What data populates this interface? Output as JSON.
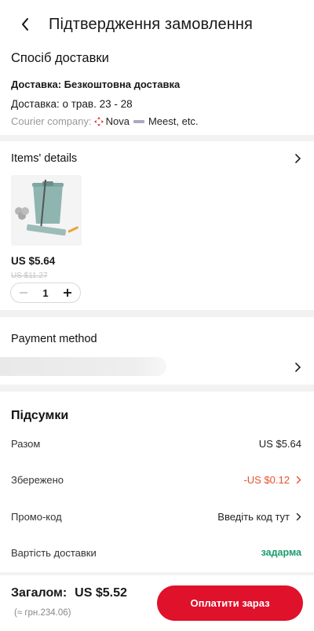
{
  "header": {
    "title": "Підтвердження замовлення"
  },
  "delivery": {
    "title": "Спосіб доставки",
    "method": "Доставка: Безкоштовна доставка",
    "date": "Доставка: о трав. 23 - 28",
    "courier_label": "Courier company:",
    "courier_nova": "Nova",
    "courier_meest": "Meest, etc."
  },
  "items": {
    "title": "Items' details",
    "price": "US $5.64",
    "old_price": "US $11.27",
    "quantity": "1"
  },
  "payment": {
    "title": "Payment method"
  },
  "summary": {
    "title": "Підсумки",
    "rows": [
      {
        "label": "Разом",
        "value": "US $5.64"
      },
      {
        "label": "Збережено",
        "value": "-US $0.12"
      },
      {
        "label": "Промо-код",
        "value": "Введіть код тут"
      },
      {
        "label": "Вартість доставки",
        "value": "задарма"
      }
    ]
  },
  "footer": {
    "total_label": "Загалом:",
    "total_amount": "US $5.52",
    "approx": "(≈ грн.234.06)",
    "pay_button": "Оплатити зараз"
  },
  "colors": {
    "accent": "#e0112b",
    "savings": "#e8502e",
    "free_shipping": "#1a9b6b"
  }
}
